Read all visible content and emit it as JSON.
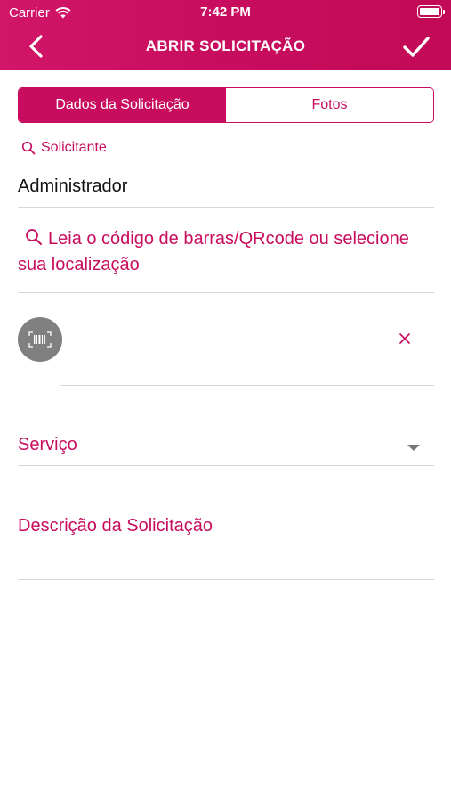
{
  "status_bar": {
    "carrier": "Carrier",
    "time": "7:42 PM"
  },
  "nav": {
    "title": "ABRIR SOLICITAÇÃO",
    "back_icon": "chevron-left-icon",
    "confirm_icon": "checkmark-icon"
  },
  "tabs": [
    {
      "label": "Dados da Solicitação",
      "active": true
    },
    {
      "label": "Fotos",
      "active": false
    }
  ],
  "form": {
    "requester_label": "Solicitante",
    "requester_value": "Administrador",
    "location_prompt": "Leia o código de barras/QRcode ou selecione sua localização",
    "barcode_icon": "barcode-scan-icon",
    "clear_icon": "close-icon",
    "service_label": "Serviço",
    "description_label": "Descrição da Solicitação"
  },
  "colors": {
    "accent": "#c80d5f",
    "barcode_button": "#808080"
  }
}
